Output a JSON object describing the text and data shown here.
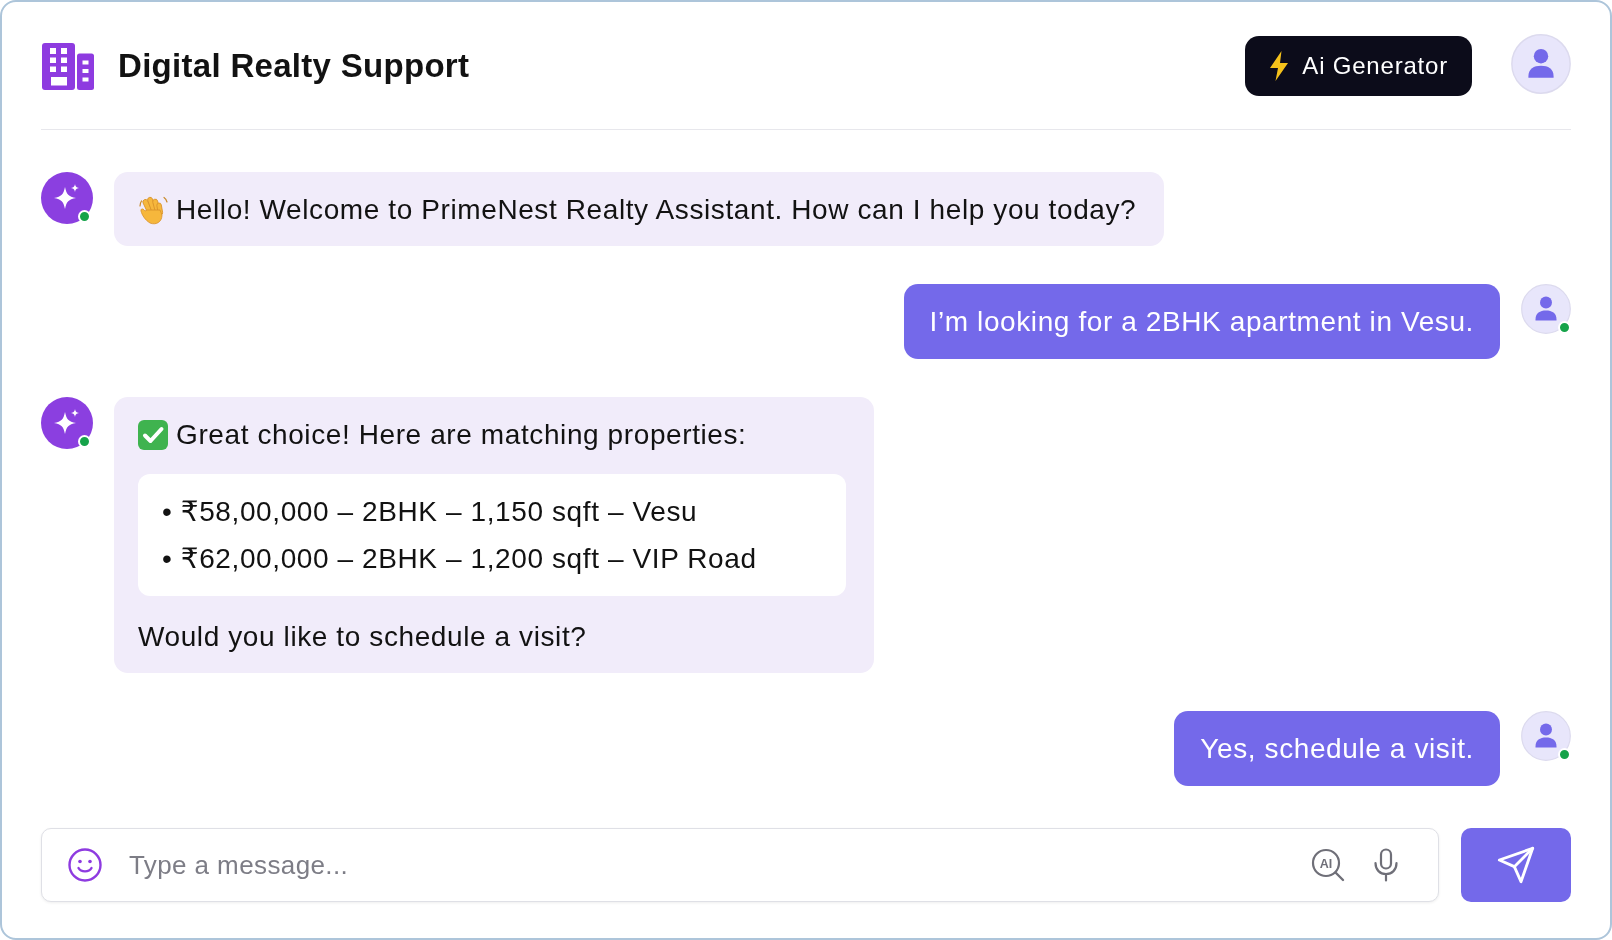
{
  "header": {
    "title": "Digital Realty Support",
    "ai_button": "Ai Generator"
  },
  "messages": [
    {
      "kind": "greeting",
      "online": true,
      "text": "Hello! Welcome to PrimeNest Realty Assistant. How can I help you today?"
    },
    {
      "kind": "reply",
      "online": true,
      "text": "I’m looking for a 2BHK apartment in Vesu."
    },
    {
      "kind": "results",
      "online": true,
      "text": "Great choice! Here are matching properties:",
      "items": [
        "• ₹58,00,000 – 2BHK – 1,150 sqft – Vesu",
        "• ₹62,00,000 – 2BHK – 1,200 sqft – VIP Road"
      ],
      "footer": "Would you like to schedule a visit?"
    },
    {
      "kind": "reply",
      "online": true,
      "text": "Yes, schedule a visit."
    }
  ],
  "composer": {
    "placeholder": "Type a message...",
    "ai_badge": "AI"
  }
}
